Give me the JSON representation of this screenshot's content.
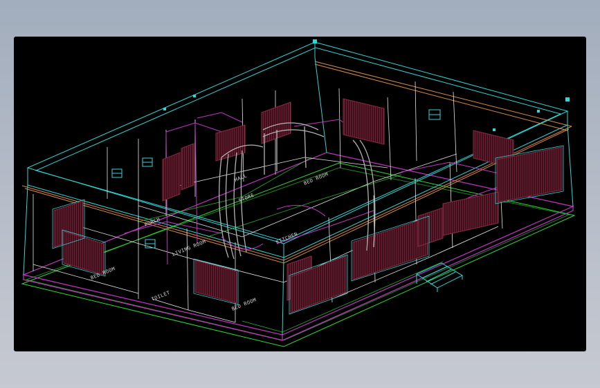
{
  "colors": {
    "background": "#000000",
    "cyan": "#33d6d6",
    "white": "#e6e6e6",
    "magenta": "#c236c2",
    "green": "#2edc2e",
    "orange": "#d98a4a",
    "maroon": "#7a1f33",
    "grey": "#b5b5b5"
  },
  "labels": {
    "bed_room_1": "BED ROOM",
    "bed_room_2": "BED ROOM",
    "bed_room_3": "BED ROOM",
    "living_room": "LIVING ROOM",
    "kitchen": "KITCHEN",
    "toilet": "TOILET",
    "store": "STORE",
    "hall": "HALL",
    "porch": "PORCH"
  }
}
